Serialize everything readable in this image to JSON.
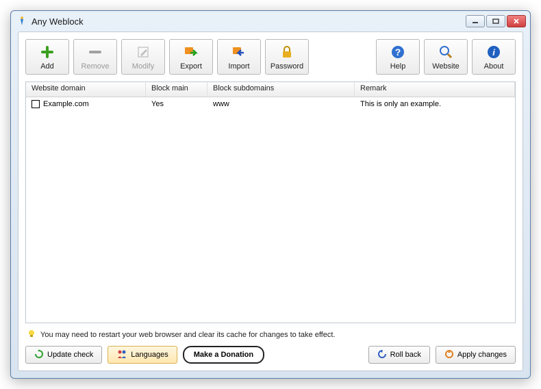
{
  "window": {
    "title": "Any Weblock"
  },
  "toolbar": {
    "add": "Add",
    "remove": "Remove",
    "modify": "Modify",
    "export": "Export",
    "import": "Import",
    "password": "Password",
    "help": "Help",
    "website": "Website",
    "about": "About"
  },
  "table": {
    "headers": {
      "domain": "Website domain",
      "blockMain": "Block main",
      "blockSub": "Block subdomains",
      "remark": "Remark"
    },
    "rows": [
      {
        "domain": "Example.com",
        "blockMain": "Yes",
        "blockSub": "www",
        "remark": "This is only an example."
      }
    ]
  },
  "hint": "You may need to restart your web browser and clear its cache for changes to take effect.",
  "footer": {
    "update": "Update check",
    "languages": "Languages",
    "donate": "Make a Donation",
    "rollback": "Roll back",
    "apply": "Apply changes"
  }
}
